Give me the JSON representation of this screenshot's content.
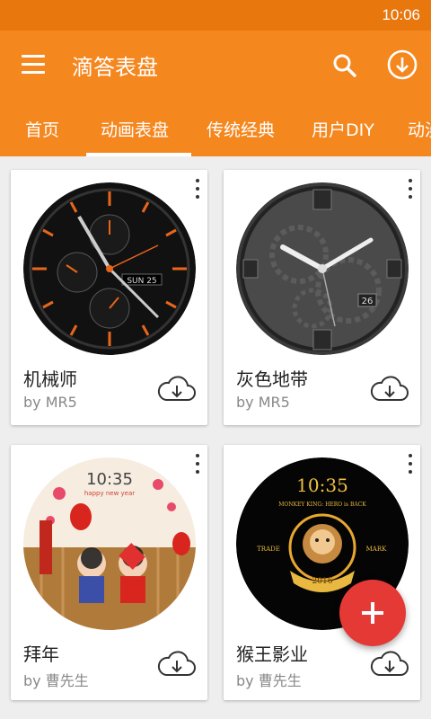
{
  "status_bar": {
    "time": "10:06"
  },
  "app_bar": {
    "title": "滴答表盘",
    "icons": [
      "menu-icon",
      "search-icon",
      "download-icon"
    ]
  },
  "tabs": [
    {
      "label": "首页"
    },
    {
      "label": "动画表盘",
      "selected": true
    },
    {
      "label": "传统经典"
    },
    {
      "label": "用户DIY"
    },
    {
      "label": "动漫"
    }
  ],
  "cards": [
    {
      "name": "机械师",
      "author": "by MR5",
      "watch_text": "SUN 25"
    },
    {
      "name": "灰色地带",
      "author": "by MR5",
      "watch_text": "26"
    },
    {
      "name": "拜年",
      "author": "by 曹先生",
      "watch_text": "10:35",
      "watch_subtext": "happy new year"
    },
    {
      "name": "猴王影业",
      "author": "by 曹先生",
      "watch_text": "10:35",
      "watch_subtext": "MONKEY KING: HERO is BACK",
      "side_left": "TRADE",
      "side_right": "MARK",
      "year": "2016"
    }
  ],
  "colors": {
    "accent": "#f5871f",
    "status": "#e8770e",
    "fab": "#e53935"
  },
  "fab": {
    "icon": "plus-icon"
  }
}
